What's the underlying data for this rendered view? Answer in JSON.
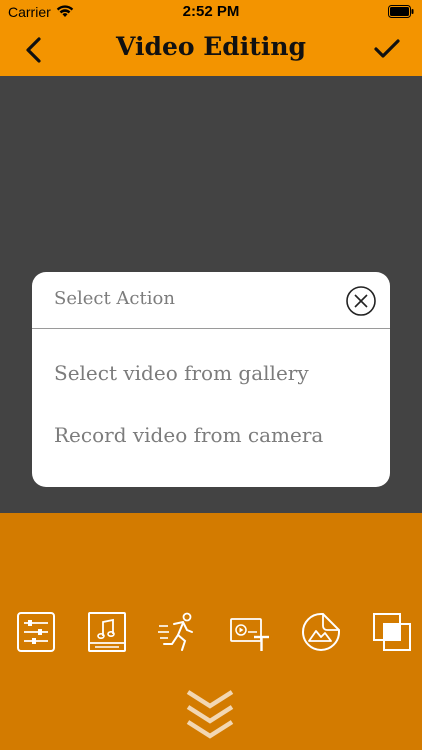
{
  "status_bar": {
    "carrier": "Carrier",
    "time": "2:52 PM"
  },
  "nav": {
    "title": "Video Editing"
  },
  "dialog": {
    "title": "Select Action",
    "options": [
      "Select video from gallery",
      "Record video from camera"
    ]
  },
  "colors": {
    "accent": "#f39400",
    "toolbar": "#d37b00",
    "preview_bg": "#434343",
    "dialog_text": "#7c7c7c"
  },
  "toolbar": {
    "tools": [
      "adjust-icon",
      "music-icon",
      "motion-icon",
      "text-overlay-icon",
      "sticker-icon",
      "overlay-icon"
    ]
  }
}
